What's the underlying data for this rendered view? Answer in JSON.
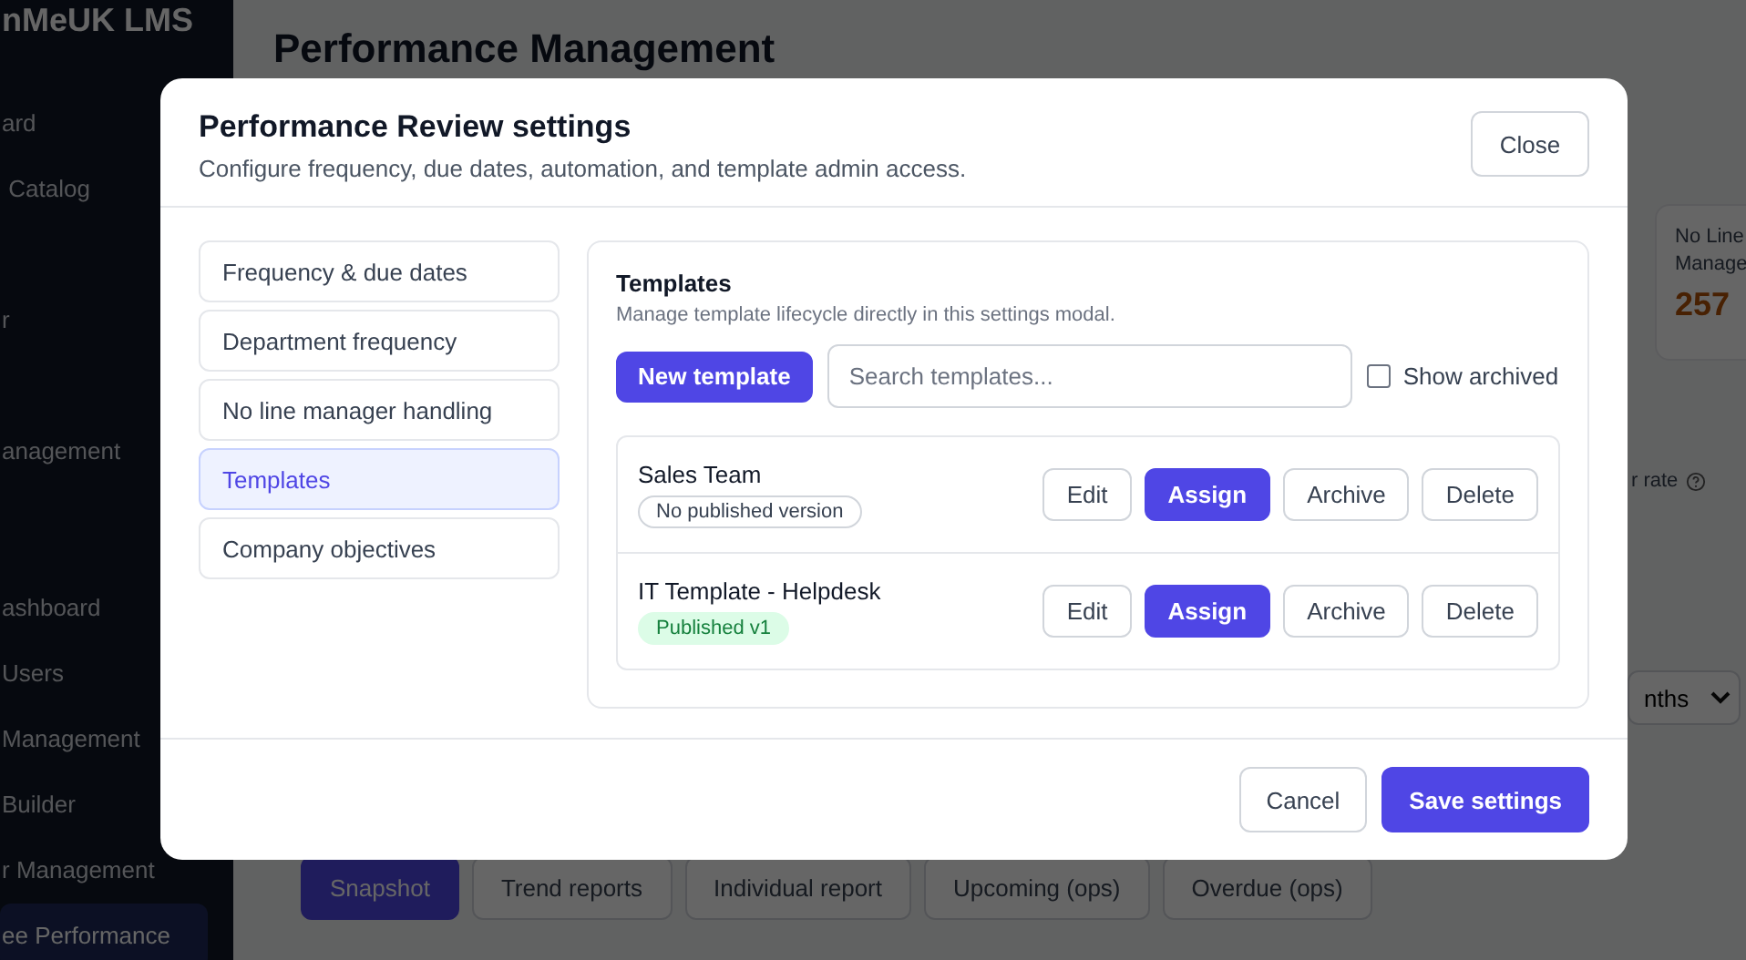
{
  "sidebar": {
    "brand": "nMeUK LMS",
    "items": [
      {
        "label": "ard",
        "selected": false
      },
      {
        "label": " Catalog",
        "selected": false
      },
      {
        "label": "r",
        "selected": false
      },
      {
        "label": "anagement",
        "selected": false
      },
      {
        "label": "ashboard",
        "selected": false
      },
      {
        "label": "Users",
        "selected": false
      },
      {
        "label": "Management",
        "selected": false
      },
      {
        "label": "Builder",
        "selected": false
      },
      {
        "label": "r Management",
        "selected": false
      },
      {
        "label": "ee Performance",
        "selected": true
      }
    ]
  },
  "page": {
    "title": "Performance Management",
    "stat_card": {
      "label": "No Line Manage",
      "value": "257"
    },
    "rate_label": "r rate",
    "period_select": {
      "value": "nths"
    },
    "tabs": [
      {
        "label": "Snapshot",
        "selected": true
      },
      {
        "label": "Trend reports",
        "selected": false
      },
      {
        "label": "Individual report",
        "selected": false
      },
      {
        "label": "Upcoming (ops)",
        "selected": false
      },
      {
        "label": "Overdue (ops)",
        "selected": false
      }
    ]
  },
  "modal": {
    "title": "Performance Review settings",
    "subtitle": "Configure frequency, due dates, automation, and template admin access.",
    "close": "Close",
    "nav": [
      {
        "label": "Frequency & due dates",
        "selected": false
      },
      {
        "label": "Department frequency",
        "selected": false
      },
      {
        "label": "No line manager handling",
        "selected": false
      },
      {
        "label": "Templates",
        "selected": true
      },
      {
        "label": "Company objectives",
        "selected": false
      }
    ],
    "templates": {
      "title": "Templates",
      "subtitle": "Manage template lifecycle directly in this settings modal.",
      "new_button": "New template",
      "search": {
        "placeholder": "Search templates..."
      },
      "show_archived": {
        "label": "Show archived",
        "checked": false
      },
      "rows": [
        {
          "name": "Sales Team",
          "status": "No published version",
          "published": false,
          "actions": [
            "Edit",
            "Assign",
            "Archive",
            "Delete"
          ]
        },
        {
          "name": "IT Template - Helpdesk",
          "status": "Published v1",
          "published": true,
          "actions": [
            "Edit",
            "Assign",
            "Archive",
            "Delete"
          ]
        }
      ]
    },
    "footer": {
      "cancel": "Cancel",
      "save": "Save settings"
    }
  }
}
